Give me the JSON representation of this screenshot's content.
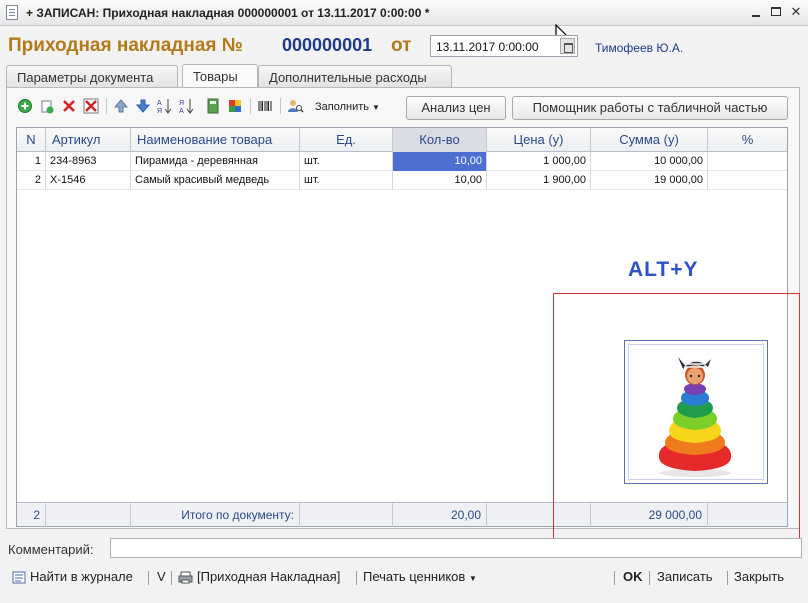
{
  "window": {
    "title": "+ ЗАПИСАН: Приходная накладная 000000001 от 13.11.2017 0:00:00 *",
    "controls": [
      "minimize-icon",
      "maximize-icon",
      "close-icon"
    ]
  },
  "header": {
    "doc_title": "Приходная накладная №",
    "doc_number": "000000001",
    "from_label": "от",
    "date_value": "13.11.2017  0:00:00",
    "author": "Тимофеев Ю.А."
  },
  "tabs": [
    {
      "label": "Параметры документа",
      "active": false
    },
    {
      "label": "Товары",
      "active": true
    },
    {
      "label": "Дополнительные расходы",
      "active": false
    }
  ],
  "toolbar": {
    "icons": [
      "add-icon",
      "copy-icon",
      "delete-icon",
      "mark-delete-icon",
      "move-up-icon",
      "move-down-icon",
      "sort-asc-icon",
      "sort-desc-icon",
      "calculator-icon",
      "color-palette-icon",
      "barcode-icon",
      "user-search-icon"
    ],
    "fill_label": "Заполнить",
    "price_analysis_label": "Анализ цен",
    "table_helper_label": "Помощник работы с табличной частью"
  },
  "table": {
    "columns": [
      "N",
      "Артикул",
      "Наименование товара",
      "Ед.",
      "Кол-во",
      "Цена (у)",
      "Сумма (у)",
      "%"
    ],
    "rows": [
      {
        "n": "1",
        "article": "234-8963",
        "name": "Пирамида - деревянная",
        "unit": "шт.",
        "qty": "10,00",
        "price": "1 000,00",
        "sum": "10 000,00",
        "pct": ""
      },
      {
        "n": "2",
        "article": "X-1546",
        "name": "Самый красивый медведь",
        "unit": "шт.",
        "qty": "10,00",
        "price": "1 900,00",
        "sum": "19 000,00",
        "pct": ""
      }
    ],
    "footer": {
      "count": "2",
      "total_label": "Итого по документу:",
      "qty_total": "20,00",
      "sum_total": "29 000,00"
    }
  },
  "hotkey_hint": "ALT+Y",
  "comment": {
    "label": "Комментарий:",
    "value": ""
  },
  "bottombar": {
    "journal_label": "Найти в журнале",
    "v_label": "V",
    "print_label": "[Приходная Накладная]",
    "price_tags_label": "Печать ценников",
    "ok_label": "OK",
    "save_label": "Записать",
    "close_label": "Закрыть"
  },
  "colors": {
    "title_accent": "#b47a1a",
    "number_blue": "#1d3b8a",
    "selection": "#4c6fd2",
    "highlight_frame": "#d9342b",
    "hint_text": "#3050c8"
  }
}
